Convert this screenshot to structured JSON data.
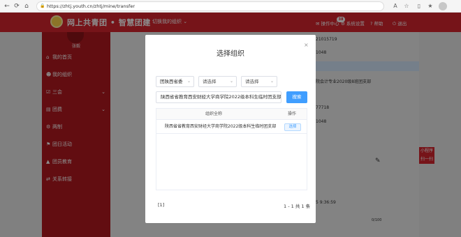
{
  "browser": {
    "url": "https://zhtj.youth.cn/zhtj/mine/transfer",
    "lock_icon": "🔒",
    "back_icon": "←",
    "refresh_icon": "⟳",
    "home_icon": "⌂"
  },
  "header": {
    "brand": "网上共青团 • 智慧团建",
    "switch_org": "切换我的组织",
    "messages": "操作中心",
    "badge": "38",
    "settings": "系统设置",
    "help": "帮助",
    "logout": "退出"
  },
  "sidebar": {
    "user": "张毅",
    "items": [
      {
        "label": "我的首页",
        "icon": "home-icon"
      },
      {
        "label": "我的组织",
        "icon": "people-icon"
      },
      {
        "label": "三会",
        "icon": "check-icon",
        "arrow": "⌄"
      },
      {
        "label": "团费",
        "icon": "folder-icon",
        "arrow": "⌄"
      },
      {
        "label": "两制",
        "icon": "gear-icon"
      },
      {
        "label": "团日活动",
        "icon": "flag-icon"
      },
      {
        "label": "团员教育",
        "icon": "graduation-icon"
      },
      {
        "label": "关系转接",
        "icon": "transfer-icon"
      }
    ]
  },
  "background": {
    "line1": "21015719",
    "line2": "1048",
    "line3": "院会计专业2020级8班团支部",
    "line4": "77718",
    "line5": "1048",
    "line6": "5 9:36:59",
    "mini_program": "小程序 扫一扫",
    "counter": "0/100"
  },
  "modal": {
    "title": "选择组织",
    "close": "×",
    "selects": [
      {
        "value": "团陕西省委"
      },
      {
        "value": "请选择"
      },
      {
        "value": "请选择"
      }
    ],
    "search_value": "陕西省省教育西安财经大学商学院2022级本科生临时团支部",
    "search_button": "搜索",
    "table": {
      "col_name": "组织全称",
      "col_action": "操作",
      "rows": [
        {
          "name": "陕西省省教育西安财经大学商学院2022级本科生临时团支部",
          "action": "选择"
        }
      ]
    },
    "page_current": "[1]",
    "page_summary": "1 - 1   共 1 条"
  }
}
